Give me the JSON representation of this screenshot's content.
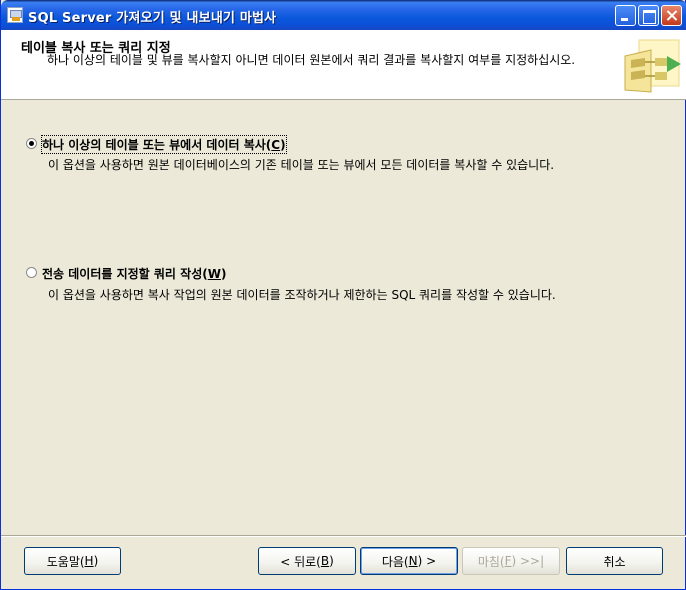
{
  "window": {
    "title": "SQL Server 가져오기 및 내보내기 마법사"
  },
  "header": {
    "title": "테이블 복사 또는 쿼리 지정",
    "description": "하나 이상의 테이블 및 뷰를 복사할지 아니면 데이터 원본에서 쿼리 결과를 복사할지 여부를 지정하십시오."
  },
  "options": [
    {
      "label_prefix": "하나 이상의 테이블 또는 뷰에서 데이터 복사(",
      "accel": "C",
      "label_suffix": ")",
      "description": "이 옵션을 사용하면 원본 데이터베이스의 기존 테이블 또는 뷰에서 모든 데이터를 복사할 수 있습니다.",
      "selected": true
    },
    {
      "label_prefix": "전송 데이터를 지정할 쿼리 작성(",
      "accel": "W",
      "label_suffix": ")",
      "description": "이 옵션을 사용하면 복사 작업의 원본 데이터를 조작하거나 제한하는 SQL 쿼리를 작성할 수 있습니다.",
      "selected": false
    }
  ],
  "buttons": {
    "help": {
      "prefix": "도움말(",
      "accel": "H",
      "suffix": ")"
    },
    "back": {
      "prefix": "< 뒤로(",
      "accel": "B",
      "suffix": ")"
    },
    "next": {
      "prefix": "다음(",
      "accel": "N",
      "suffix": ") >"
    },
    "finish": {
      "prefix": "마침(",
      "accel": "F",
      "suffix": ") >>|"
    },
    "cancel": {
      "label": "취소"
    }
  },
  "colors": {
    "titlebar": "#0A58DC",
    "face": "#ECE9D8",
    "accent_border": "#003C74"
  }
}
